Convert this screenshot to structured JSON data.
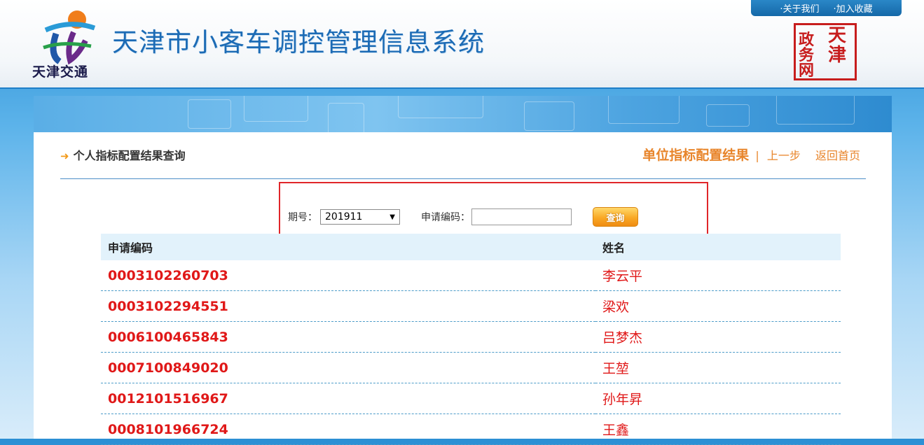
{
  "header": {
    "logo_text": "天津交通",
    "title": "天津市小客车调控管理信息系统",
    "toplinks": [
      "·关于我们",
      "·加入收藏"
    ],
    "seal_chars": [
      "天",
      "津",
      "政",
      "务",
      "网"
    ]
  },
  "page": {
    "heading": "个人指标配置结果查询",
    "links": {
      "unit_result": "单位指标配置结果",
      "separator": "|",
      "prev_step": "上一步",
      "home": "返回首页"
    }
  },
  "form": {
    "period_label": "期号：",
    "period_value": "201911",
    "code_label": "申请编码：",
    "code_value": "",
    "query_button": "查询"
  },
  "table": {
    "headers": [
      "申请编码",
      "姓名"
    ],
    "rows": [
      [
        "0003102260703",
        "李云平"
      ],
      [
        "0003102294551",
        "梁欢"
      ],
      [
        "0006100465843",
        "吕梦杰"
      ],
      [
        "0007100849020",
        "王堃"
      ],
      [
        "0012101516967",
        "孙年昇"
      ],
      [
        "0008101966724",
        "王鑫"
      ]
    ]
  },
  "colors": {
    "accent_orange": "#e8852b",
    "result_red": "#e01818",
    "brand_blue": "#1c6bb5"
  }
}
